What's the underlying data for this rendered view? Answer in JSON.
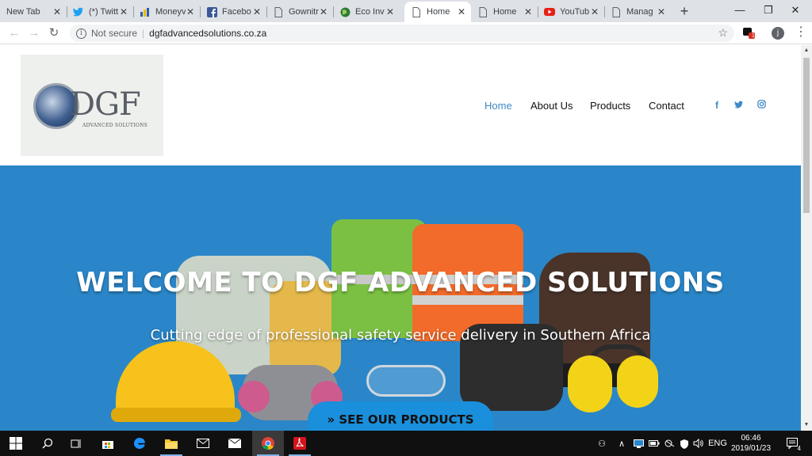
{
  "browser": {
    "tabs": [
      {
        "title": "New Tab",
        "icon": "none",
        "active": false
      },
      {
        "title": "(*) Twitt",
        "icon": "twitter-icon",
        "active": false
      },
      {
        "title": "Moneyv",
        "icon": "chart-icon",
        "active": false
      },
      {
        "title": "Facebo",
        "icon": "facebook-icon",
        "active": false
      },
      {
        "title": "Gownitr",
        "icon": "page-icon",
        "active": false
      },
      {
        "title": "Eco Inv",
        "icon": "globe-icon",
        "active": false
      },
      {
        "title": "Home",
        "icon": "page-icon",
        "active": true
      },
      {
        "title": "Home",
        "icon": "page-icon",
        "active": false
      },
      {
        "title": "YouTub",
        "icon": "youtube-icon",
        "active": false
      },
      {
        "title": "Manag",
        "icon": "page-icon",
        "active": false
      }
    ],
    "tab_close_glyph": "✕",
    "new_tab_glyph": "+",
    "window_controls": {
      "minimize": "—",
      "restore": "❐",
      "close": "✕"
    },
    "nav": {
      "back": "←",
      "forward": "→",
      "reload": "↻"
    },
    "security_label": "Not secure",
    "url": "dgfadvancedsolutions.co.za",
    "bookmark_glyph": "☆",
    "extension_badge": "1",
    "profile_initial": "j",
    "menu_glyph": "⋮"
  },
  "site": {
    "logo": {
      "main": "DGF",
      "sub": "ADVANCED SOLUTIONS"
    },
    "nav": [
      {
        "label": "Home",
        "active": true
      },
      {
        "label": "About Us",
        "active": false
      },
      {
        "label": "Products",
        "active": false
      },
      {
        "label": "Contact",
        "active": false
      }
    ],
    "social": [
      {
        "name": "facebook-icon",
        "glyph": "f"
      },
      {
        "name": "twitter-icon",
        "glyph": "🐦"
      },
      {
        "name": "instagram-icon",
        "glyph": "◎"
      }
    ],
    "hero": {
      "title": "WELCOME TO DGF ADVANCED SOLUTIONS",
      "subtitle": "Cutting edge of professional safety service delivery in Southern Africa",
      "cta": "» SEE OUR PRODUCTS"
    },
    "colors": {
      "accent": "#3f88c5",
      "hero_bg": "#2a86c8",
      "cta_bg": "#1a8fdb"
    }
  },
  "taskbar": {
    "apps": [
      {
        "name": "start-icon",
        "glyph": "⊞"
      },
      {
        "name": "search-icon",
        "glyph": "⌕"
      },
      {
        "name": "task-view-icon",
        "glyph": "⧉"
      },
      {
        "name": "store-icon",
        "glyph": "🛍"
      },
      {
        "name": "edge-icon",
        "glyph": "e"
      },
      {
        "name": "file-explorer-icon",
        "glyph": "📁"
      },
      {
        "name": "mail-icon",
        "glyph": "✉"
      },
      {
        "name": "mail-app-icon",
        "glyph": "✉"
      },
      {
        "name": "chrome-icon",
        "glyph": "◉"
      },
      {
        "name": "acrobat-icon",
        "glyph": "A"
      }
    ],
    "tray": {
      "people": "⚇",
      "chevron": "∧",
      "language": "ENG",
      "notifications": "🗨",
      "notification_count": "4"
    },
    "time": "06:46",
    "date": "2019/01/23"
  }
}
